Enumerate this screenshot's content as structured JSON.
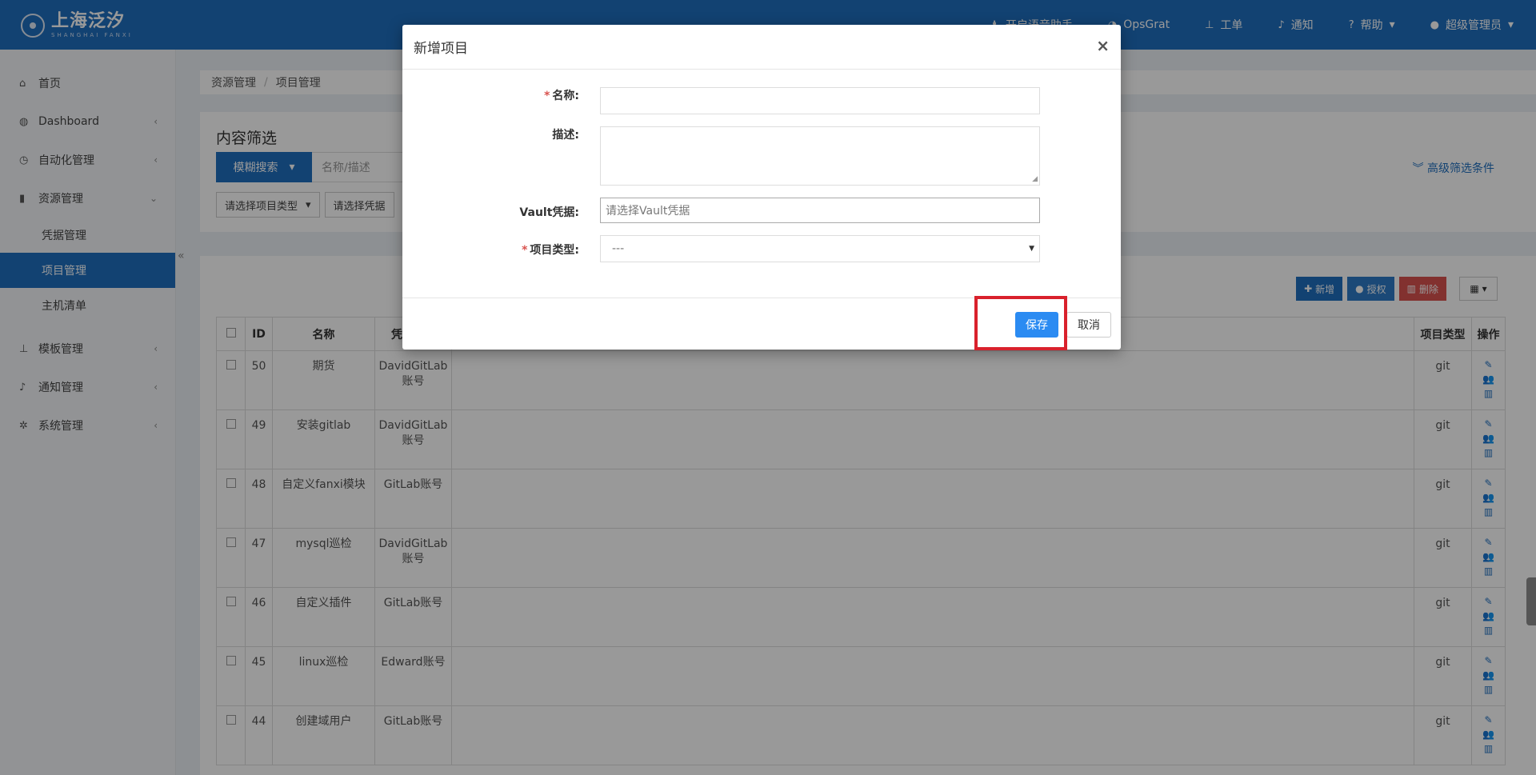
{
  "header": {
    "logo_cn": "上海泛汐",
    "logo_en": "SHANGHAI FANXI",
    "nav": [
      {
        "label": "开启语音助手",
        "icon": "person-icon"
      },
      {
        "label": "OpsGrat",
        "icon": "bird-icon"
      },
      {
        "label": "工单",
        "icon": "sitemap-icon"
      },
      {
        "label": "通知",
        "icon": "bell-icon"
      },
      {
        "label": "帮助",
        "icon": "question-icon"
      },
      {
        "label": "超级管理员",
        "icon": "user-icon"
      }
    ]
  },
  "sidebar": {
    "items": [
      {
        "label": "首页",
        "icon": "home-icon"
      },
      {
        "label": "Dashboard",
        "icon": "dashboard-icon"
      },
      {
        "label": "自动化管理",
        "icon": "clock-icon"
      },
      {
        "label": "资源管理",
        "icon": "book-icon"
      },
      {
        "label": "模板管理",
        "icon": "sitemap-icon"
      },
      {
        "label": "通知管理",
        "icon": "bell-icon"
      },
      {
        "label": "系统管理",
        "icon": "gear-icon"
      }
    ],
    "subitems": [
      "凭据管理",
      "项目管理",
      "主机清单"
    ]
  },
  "breadcrumb": {
    "parent": "资源管理",
    "separator": "/",
    "current": "项目管理"
  },
  "filter": {
    "title": "内容筛选",
    "search_mode": "模糊搜索",
    "search_placeholder": "名称/描述",
    "project_type_select": "请选择项目类型",
    "credential_select": "请选择凭据",
    "advanced": "高级筛选条件"
  },
  "toolbar": {
    "add": "新增",
    "authorize": "授权",
    "delete": "删除"
  },
  "table": {
    "headers": [
      "ID",
      "名称",
      "凭",
      "项目类型",
      "操作"
    ],
    "rows": [
      {
        "id": "50",
        "name": "期货",
        "cred": [
          "DavidGitLab",
          "账号"
        ],
        "type": "git"
      },
      {
        "id": "49",
        "name": "安装gitlab",
        "cred": [
          "DavidGitLab",
          "账号"
        ],
        "type": "git"
      },
      {
        "id": "48",
        "name": "自定义fanxi模块",
        "cred": [
          "GitLab账号"
        ],
        "type": "git"
      },
      {
        "id": "47",
        "name": "mysql巡检",
        "cred": [
          "DavidGitLab",
          "账号"
        ],
        "type": "git"
      },
      {
        "id": "46",
        "name": "自定义插件",
        "cred": [
          "GitLab账号"
        ],
        "type": "git"
      },
      {
        "id": "45",
        "name": "linux巡检",
        "cred": [
          "Edward账号"
        ],
        "type": "git"
      },
      {
        "id": "44",
        "name": "创建域用户",
        "cred": [
          "GitLab账号"
        ],
        "type": "git"
      }
    ]
  },
  "modal": {
    "title": "新增项目",
    "close": "×",
    "fields": {
      "name_label": "名称:",
      "name_value": "",
      "desc_label": "描述:",
      "desc_value": "",
      "vault_label": "Vault凭据:",
      "vault_placeholder": "请选择Vault凭据",
      "type_label": "项目类型:",
      "type_value": "---"
    },
    "save": "保存",
    "cancel": "取消"
  },
  "colors": {
    "primary": "#1e6ebf",
    "danger": "#d9534f",
    "highlight": "#d9212c",
    "save": "#2b8bf2"
  }
}
